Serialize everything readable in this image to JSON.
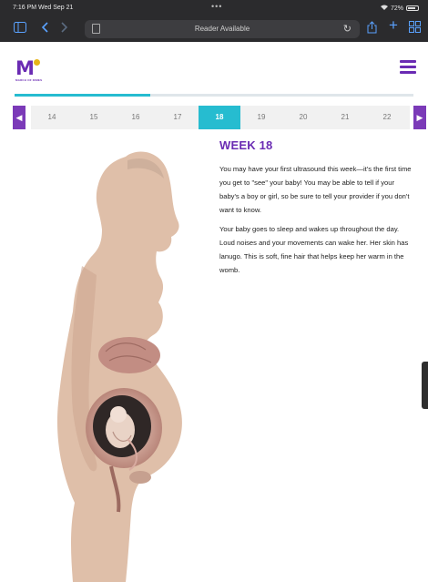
{
  "status_bar": {
    "time": "7:16 PM  Wed Sep 21",
    "dots": "•••",
    "battery": "72%"
  },
  "browser": {
    "url_label": "Reader Available",
    "icons": [
      "sidebar-icon",
      "back-icon",
      "forward-icon",
      "reader-icon",
      "reload-icon",
      "share-icon",
      "new-tab-icon",
      "tabs-icon"
    ]
  },
  "site": {
    "logo_text": "M",
    "logo_subtext": "MARCH OF DIMES",
    "menu_icon": "hamburger-icon",
    "brand_color": "#6a2bb3",
    "accent_color": "#26bcd0"
  },
  "progress": {
    "fraction": 0.34
  },
  "week_nav": {
    "weeks": [
      "14",
      "15",
      "16",
      "17",
      "18",
      "19",
      "20",
      "21",
      "22"
    ],
    "active_week": "18",
    "prev_icon": "chevron-left-icon",
    "next_icon": "chevron-right-icon"
  },
  "article": {
    "title": "WEEK 18",
    "paragraphs": [
      "You may have your first ultrasound this week—it's the first time you get to \"see\" your baby! You may be able to tell if your baby's a boy or girl, so be sure to tell your provider if you don't want to know.",
      "Your baby goes to sleep and wakes up throughout the day. Loud noises and your movements can wake her. Her skin has lanugo. This is soft, fine hair that helps keep her warm in the womb."
    ]
  }
}
